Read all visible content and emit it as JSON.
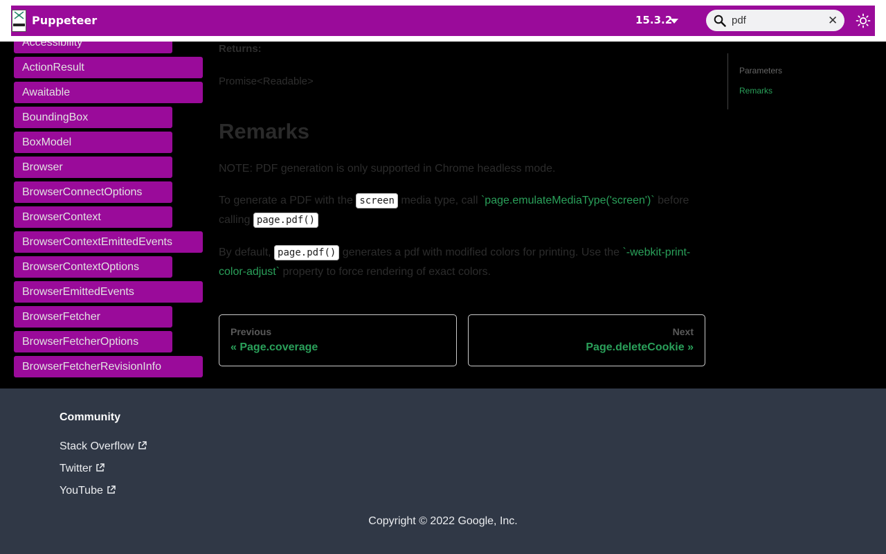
{
  "navbar": {
    "brand": "Puppeteer",
    "version": "15.3.2",
    "search_value": "pdf",
    "clear_symbol": "✕",
    "colors": {
      "bar": "#9a0b9a",
      "accent_link": "#2aa05a"
    }
  },
  "sidebar": {
    "items": [
      {
        "label": "Accessibility"
      },
      {
        "label": "ActionResult"
      },
      {
        "label": "Awaitable"
      },
      {
        "label": "BoundingBox"
      },
      {
        "label": "BoxModel"
      },
      {
        "label": "Browser"
      },
      {
        "label": "BrowserConnectOptions"
      },
      {
        "label": "BrowserContext"
      },
      {
        "label": "BrowserContextEmittedEvents"
      },
      {
        "label": "BrowserContextOptions"
      },
      {
        "label": "BrowserEmittedEvents"
      },
      {
        "label": "BrowserFetcher"
      },
      {
        "label": "BrowserFetcherOptions"
      },
      {
        "label": "BrowserFetcherRevisionInfo"
      }
    ]
  },
  "main": {
    "returns_label": "Returns:",
    "returns_value": "Promise<Readable>",
    "remarks_heading": "Remarks",
    "note": "NOTE: PDF generation is only supported in Chrome headless mode.",
    "p2": {
      "text1": "To generate a PDF with the ",
      "code1": "screen",
      "text2": " media type, call ",
      "link1": "`page.emulateMediaType('screen')`",
      "text3": " before calling ",
      "code2": "page.pdf()"
    },
    "p3": {
      "text1": "By default, ",
      "code1": "page.pdf()",
      "text2": " generates a pdf with modified colors for printing. Use the ",
      "link1": "`-webkit-print-color-adjust`",
      "text3": " property to force rendering of exact colors."
    }
  },
  "toc": {
    "items": [
      {
        "label": "Parameters"
      },
      {
        "label": "Remarks"
      }
    ]
  },
  "pagination": {
    "prev_sub": "Previous",
    "prev_title": "« Page.coverage",
    "next_sub": "Next",
    "next_title": "Page.deleteCookie »"
  },
  "footer": {
    "heading": "Community",
    "links": [
      {
        "label": "Stack Overflow"
      },
      {
        "label": "Twitter"
      },
      {
        "label": "YouTube"
      }
    ],
    "copyright": "Copyright © 2022 Google, Inc."
  }
}
